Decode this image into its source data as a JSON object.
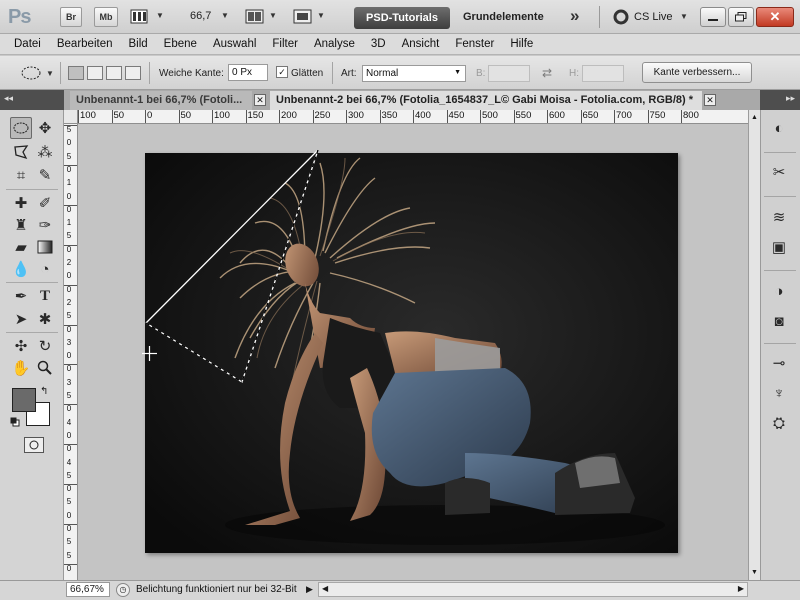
{
  "app": {
    "logo": "Ps",
    "bridge_label": "Br",
    "minibridge_label": "Mb",
    "zoom_value": "66,7",
    "workspace_active": "PSD-Tutorials",
    "workspace_other": "Grundelemente",
    "more_workspaces": "»",
    "cslive_label": "CS Live"
  },
  "menu": [
    "Datei",
    "Bearbeiten",
    "Bild",
    "Ebene",
    "Auswahl",
    "Filter",
    "Analyse",
    "3D",
    "Ansicht",
    "Fenster",
    "Hilfe"
  ],
  "options": {
    "feather_label": "Weiche Kante:",
    "feather_value": "0 Px",
    "antialias_label": "Glätten",
    "antialias_checked": "✓",
    "style_label": "Art:",
    "style_value": "Normal",
    "width_label": "B:",
    "height_label": "H:",
    "refine_button": "Kante verbessern..."
  },
  "tabs": [
    {
      "title": "Unbenannt-1 bei 66,7% (Fotoli..."
    },
    {
      "title": "Unbenannt-2 bei 66,7% (Fotolia_1654837_L© Gabi Moisa - Fotolia.com, RGB/8) *"
    }
  ],
  "ruler": {
    "h_labels": [
      "100",
      "50",
      "0",
      "50",
      "100",
      "150",
      "200",
      "250",
      "300",
      "350",
      "400",
      "450",
      "500",
      "550",
      "600",
      "650",
      "700",
      "750",
      "800"
    ],
    "v_labels": [
      "5",
      "0",
      "5",
      "0",
      "1",
      "0",
      "0",
      "1",
      "5",
      "0",
      "2",
      "0",
      "0",
      "2",
      "5",
      "0",
      "3",
      "0",
      "0",
      "3",
      "5",
      "0",
      "4",
      "0",
      "0",
      "4",
      "5",
      "0",
      "5",
      "0",
      "0",
      "5",
      "5",
      "0"
    ]
  },
  "status": {
    "zoom": "66,67%",
    "message": "Belichtung funktioniert nur bei 32-Bit"
  },
  "colors": {
    "foreground": "#6a6a6a",
    "background": "#ffffff"
  }
}
